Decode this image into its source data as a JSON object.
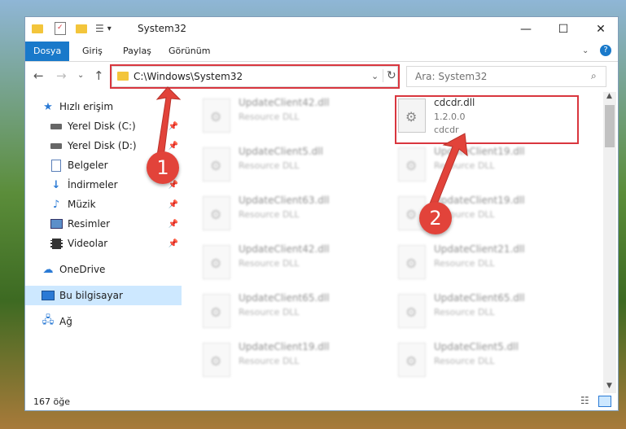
{
  "window": {
    "title": "System32"
  },
  "quick_access_toolbar": {
    "dropdown_arrow": "▾"
  },
  "ribbon": {
    "tabs": [
      "Dosya",
      "Giriş",
      "Paylaş",
      "Görünüm"
    ],
    "active_tab": "Dosya"
  },
  "address_bar": {
    "path": "C:\\Windows\\System32"
  },
  "search": {
    "placeholder": "Ara: System32"
  },
  "sidebar": {
    "items": [
      {
        "label": "Hızlı erişim",
        "icon": "star-icon"
      },
      {
        "label": "Yerel Disk (C:)",
        "icon": "drive-icon"
      },
      {
        "label": "Yerel Disk (D:)",
        "icon": "drive-icon"
      },
      {
        "label": "Belgeler",
        "icon": "document-icon"
      },
      {
        "label": "İndirmeler",
        "icon": "download-icon"
      },
      {
        "label": "Müzik",
        "icon": "music-icon"
      },
      {
        "label": "Resimler",
        "icon": "image-icon"
      },
      {
        "label": "Videolar",
        "icon": "film-icon"
      },
      {
        "label": "OneDrive",
        "icon": "cloud-icon"
      },
      {
        "label": "Bu bilgisayar",
        "icon": "computer-icon"
      },
      {
        "label": "Ağ",
        "icon": "network-icon"
      }
    ]
  },
  "files": {
    "highlighted": {
      "name": "cdcdr.dll",
      "version": "1.2.0.0",
      "description": "cdcdr"
    },
    "background": [
      {
        "name": "UpdateClient42.dll",
        "type": "Resource DLL"
      },
      {
        "name": "UpdateClient5.dll",
        "type": "Resource DLL"
      },
      {
        "name": "UpdateClient19.dll",
        "type": "Resource DLL"
      },
      {
        "name": "UpdateClient63.dll",
        "type": "Resource DLL"
      },
      {
        "name": "UpdateClient19.dll",
        "type": "Resource DLL"
      },
      {
        "name": "UpdateClient42.dll",
        "type": "Resource DLL"
      },
      {
        "name": "UpdateClient21.dll",
        "type": "Resource DLL"
      },
      {
        "name": "UpdateClient65.dll",
        "type": "Resource DLL"
      },
      {
        "name": "UpdateClient65.dll",
        "type": "Resource DLL"
      },
      {
        "name": "UpdateClient19.dll",
        "type": "Resource DLL"
      },
      {
        "name": "UpdateClient5.dll",
        "type": "Resource DLL"
      }
    ]
  },
  "status": {
    "item_count": "167 öğe"
  },
  "annotations": {
    "badge_1": "1",
    "badge_2": "2",
    "color": "#e2433a"
  }
}
